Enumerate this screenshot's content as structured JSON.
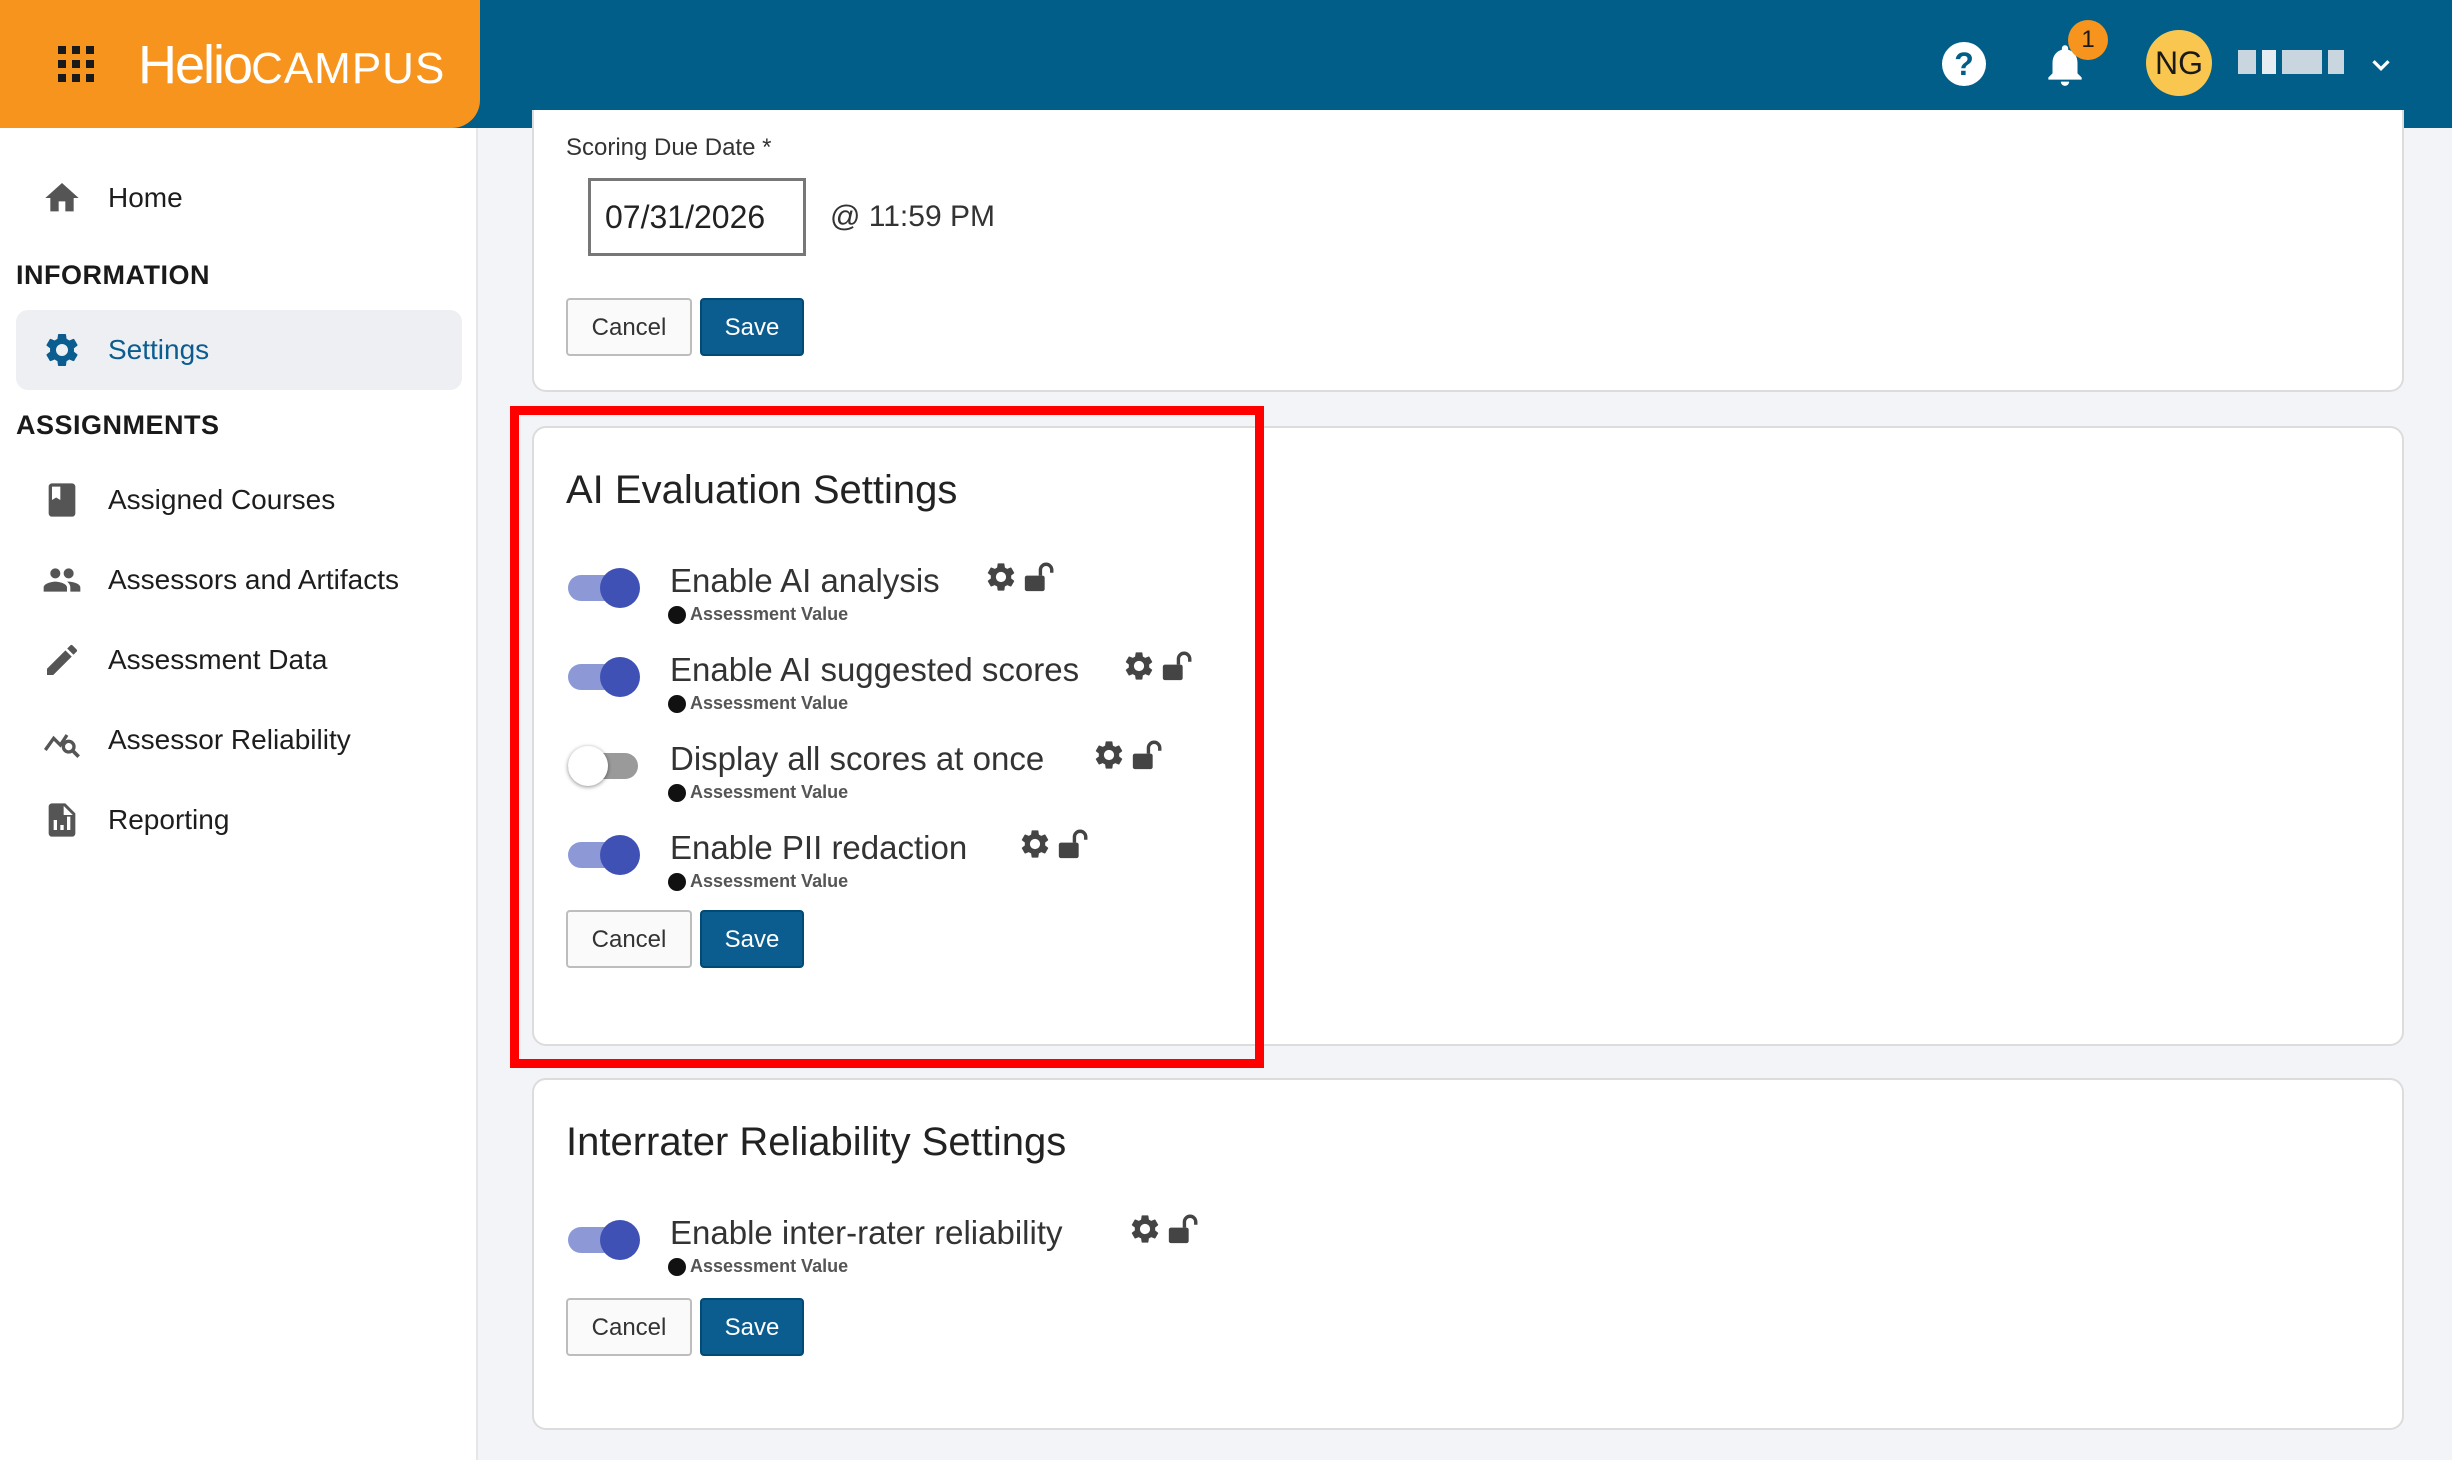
{
  "header": {
    "logo_part1": "Helio",
    "logo_part2": "CAMPUS",
    "notification_count": "1",
    "user_initials": "NG",
    "help_glyph": "?"
  },
  "sidebar": {
    "home_label": "Home",
    "information_title": "INFORMATION",
    "settings_label": "Settings",
    "assignments_title": "ASSIGNMENTS",
    "items": [
      {
        "label": "Assigned Courses",
        "icon": "book-icon"
      },
      {
        "label": "Assessors and Artifacts",
        "icon": "people-icon"
      },
      {
        "label": "Assessment Data",
        "icon": "pencil-icon"
      },
      {
        "label": "Assessor Reliability",
        "icon": "reliability-chart-icon"
      },
      {
        "label": "Reporting",
        "icon": "report-icon"
      }
    ]
  },
  "scoring": {
    "label": "Scoring Due Date *",
    "date_value": "07/31/2026",
    "time": "@ 11:59 PM",
    "cancel": "Cancel",
    "save": "Save"
  },
  "ai_settings": {
    "title": "AI Evaluation Settings",
    "options": [
      {
        "label": "Enable AI analysis",
        "sub": "Assessment Value",
        "enabled": true
      },
      {
        "label": "Enable AI suggested scores",
        "sub": "Assessment Value",
        "enabled": true
      },
      {
        "label": "Display all scores at once",
        "sub": "Assessment Value",
        "enabled": false
      },
      {
        "label": "Enable PII redaction",
        "sub": "Assessment Value",
        "enabled": true
      }
    ],
    "cancel": "Cancel",
    "save": "Save"
  },
  "interrater": {
    "title": "Interrater Reliability Settings",
    "options": [
      {
        "label": "Enable inter-rater reliability",
        "sub": "Assessment Value",
        "enabled": true
      }
    ],
    "cancel": "Cancel",
    "save": "Save"
  },
  "colors": {
    "header": "#005e89",
    "brand": "#f7941d",
    "primary": "#0b5d8f",
    "toggle_on": "#3f51b5",
    "highlight": "#ff0000"
  }
}
